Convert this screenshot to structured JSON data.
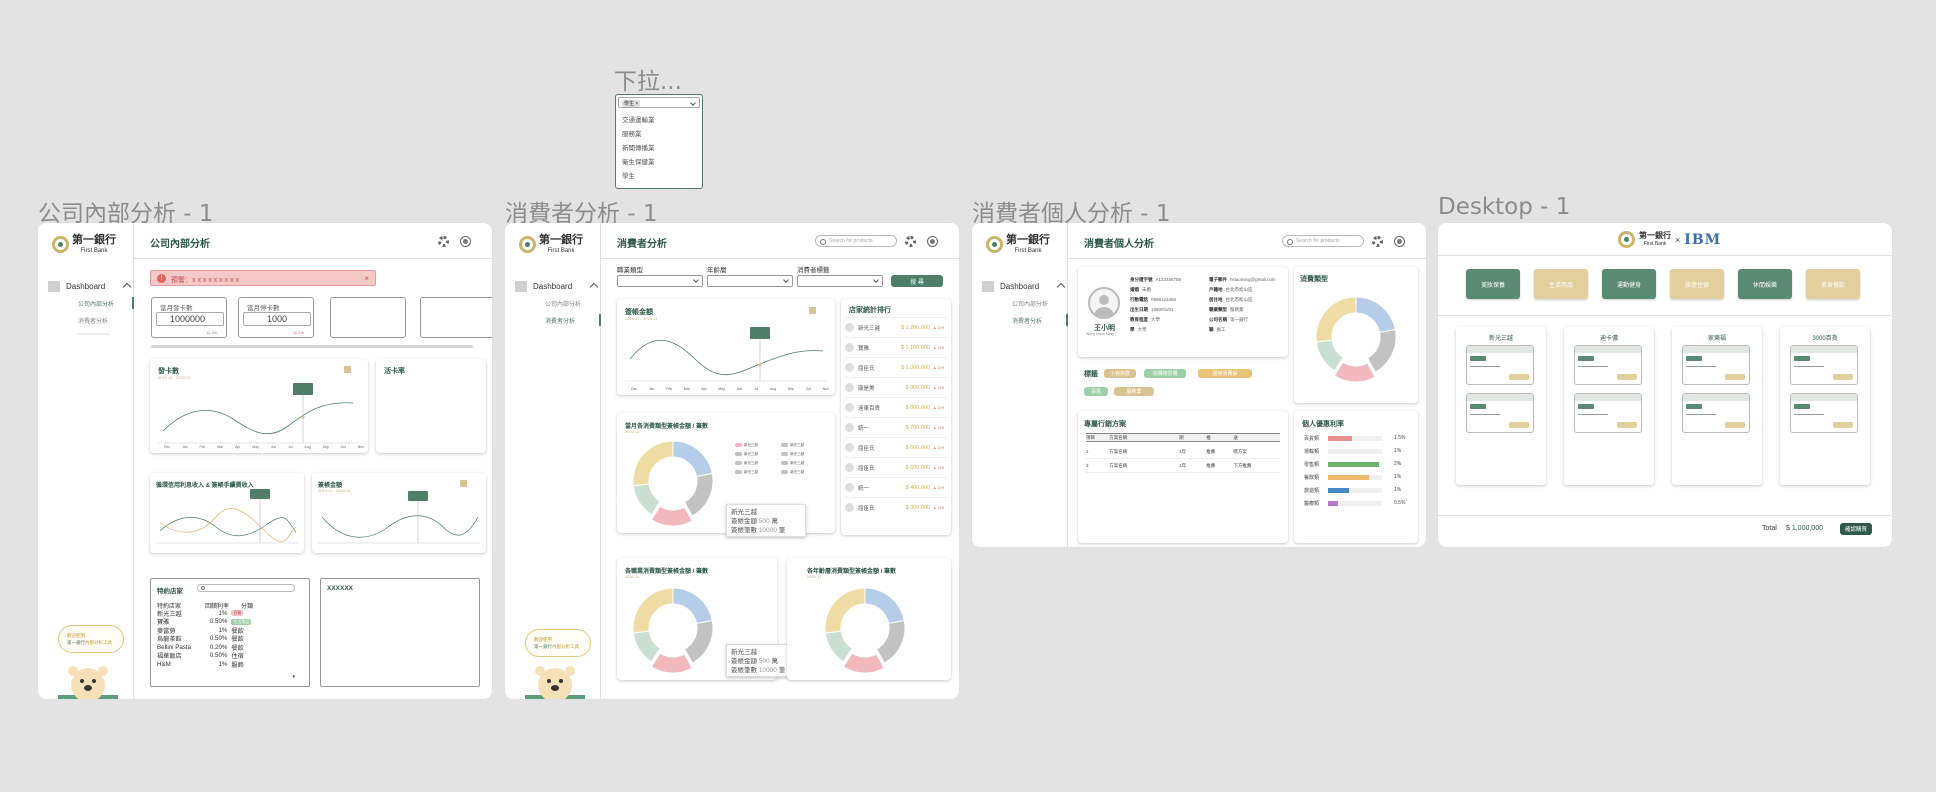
{
  "dropdown_annotation": {
    "title": "下拉...",
    "chip": "學生 ×",
    "options": [
      "交通運輸業",
      "服務業",
      "新聞傳播業",
      "衛生保健業",
      "學生"
    ]
  },
  "frame_titles": [
    "公司內部分析 - 1",
    "消費者分析 - 1",
    "消費者個人分析 - 1",
    "Desktop - 1"
  ],
  "brand": {
    "name_zh": "第一銀行",
    "name_en": "First Bank",
    "partner": "IBM",
    "x": "×"
  },
  "colors": {
    "primary": "#4e7e68",
    "gold": "#d9c48f",
    "alert": "#f6c9c9",
    "pie_blue": "#b5cde9",
    "pie_gray": "#c2c2c2",
    "pie_pink": "#f2b8bb",
    "pie_mint": "#c9dfd0",
    "pie_yellow": "#eedca4"
  },
  "icons": [
    "settings-gear-icon",
    "user-avatar-icon",
    "search-icon",
    "close-icon",
    "chevron-down-icon",
    "nav-square-icon"
  ],
  "sidebar": {
    "dashboard": "Dashboard",
    "items": [
      "公司內部分析",
      "消費者分析"
    ],
    "bubble1": "歡迎使用",
    "bubble2": "第一銀行",
    "bubble3": "內部分析工具"
  },
  "screen1": {
    "title": "公司內部分析",
    "alert": "預警：x x x x x x x x x",
    "kpi1": {
      "label": "當月發卡數",
      "value": "1000000",
      "delta": "11.1%"
    },
    "kpi2": {
      "label": "當月停卡數",
      "value": "1000",
      "delta": "11.1%"
    },
    "chart1_title": "發卡數",
    "chart1_date": "2019.12 - 2020.11",
    "chart2_title": "活卡率",
    "chart3_title": "循環信用利息收入 & 簽帳手續費收入",
    "chart4_title": "簽帳金額",
    "chart4_date": "2019.12 - 2020.11",
    "months": [
      "Dec",
      "Jan",
      "Feb",
      "Mar",
      "Apr",
      "May",
      "Jun",
      "Jul",
      "Aug",
      "Sep",
      "Oct",
      "Nov"
    ],
    "partner_title": "特約店家",
    "partner_headers": [
      "特約店家",
      "回饋利率",
      "分類"
    ],
    "partners": [
      {
        "name": "新光三越",
        "rate": "1%",
        "cat": "百貨"
      },
      {
        "name": "寶雅",
        "rate": "0.50%",
        "cat": "生活用品"
      },
      {
        "name": "麥當勞",
        "rate": "1%",
        "cat": "餐飲"
      },
      {
        "name": "烏龍茶館",
        "rate": "0.50%",
        "cat": "餐飲"
      },
      {
        "name": "Bellini Pasta",
        "rate": "0.20%",
        "cat": "餐飲"
      },
      {
        "name": "福華飯店",
        "rate": "0.50%",
        "cat": "住宿"
      },
      {
        "name": "H&M",
        "rate": "1%",
        "cat": "服飾"
      }
    ],
    "box_title": "XXXXXX"
  },
  "screen2": {
    "title": "消費者分析",
    "search_placeholder": "Search for products",
    "filter_labels": [
      "職業類型",
      "年齡層",
      "消費者標籤"
    ],
    "search_btn": "搜 尋",
    "line_title": "簽帳金額",
    "line_date": "2019.12 - 2020.11",
    "rank_title": "店家統計排行",
    "rank": [
      {
        "name": "新光三越",
        "amount": "$ 1,200,000",
        "delta": "11%"
      },
      {
        "name": "寶雅",
        "amount": "$ 1,100,000",
        "delta": "11%"
      },
      {
        "name": "屈臣氏",
        "amount": "$ 1,000,000",
        "delta": "11%"
      },
      {
        "name": "康是美",
        "amount": "$ 900,000",
        "delta": "11%"
      },
      {
        "name": "遠東百貨",
        "amount": "$ 800,000",
        "delta": "11%"
      },
      {
        "name": "統一",
        "amount": "$ 700,000",
        "delta": "11%"
      },
      {
        "name": "屈臣氏",
        "amount": "$ 600,000",
        "delta": "11%"
      },
      {
        "name": "屈臣氏",
        "amount": "$ 500,000",
        "delta": "11%"
      },
      {
        "name": "統一",
        "amount": "$ 400,000",
        "delta": "11%"
      },
      {
        "name": "屈臣氏",
        "amount": "$ 300,000",
        "delta": "11%"
      }
    ],
    "pie1_title": "當月各消費類型簽帳金額 / 筆數",
    "pie1_date": "2020.11",
    "legend_items": [
      "新光三越",
      "新光三越",
      "新光三越",
      "新光三越",
      "新光三越",
      "新光三越",
      "新光三越",
      "新光三越"
    ],
    "tooltip": {
      "title": "新光三越",
      "amount_label": "簽帳金額",
      "amount": "500",
      "amount_unit": "萬",
      "count_label": "簽帳筆數",
      "count": "10000",
      "count_unit": "筆"
    },
    "pie2_title": "各職業消費類型簽帳金額 / 筆數",
    "pie2_date": "2020.11",
    "pie3_title": "各年齡層消費類型簽帳金額 / 筆數",
    "pie3_date": "2020.11"
  },
  "screen3": {
    "title": "消費者個人分析",
    "search_placeholder": "Search for products",
    "profile": {
      "name": "王小明",
      "name_en": "Wang Hsiao Ming"
    },
    "info": [
      {
        "k": "身分證字號",
        "v": "A123456789"
      },
      {
        "k": "電子郵件",
        "v": "hsiaoming@gmail.com"
      },
      {
        "k": "婚姻",
        "v": "未婚"
      },
      {
        "k": "戶籍地",
        "v": "台北市松山區"
      },
      {
        "k": "行動電話",
        "v": "0988123456"
      },
      {
        "k": "居住地",
        "v": "台北市松山區"
      },
      {
        "k": "出生日期",
        "v": "1990/01/01"
      },
      {
        "k": "職業類型",
        "v": "服務業"
      },
      {
        "k": "教育程度",
        "v": "大學"
      },
      {
        "k": "公司名稱",
        "v": "第一銀行"
      },
      {
        "k": "學",
        "v": "大學"
      },
      {
        "k": "職",
        "v": "員工"
      }
    ],
    "type_title": "消費類型",
    "tags_title": "標籤",
    "tags": [
      "小資族群",
      "有購物習慣",
      "經常消費保",
      "百貨",
      "服務業"
    ],
    "plan_title": "專屬行銷方案",
    "plan_headers": [
      "項目",
      "方案名稱",
      "期",
      "推",
      "送"
    ],
    "plans": [
      {
        "no": "1",
        "name": "方案名稱",
        "period": "1年",
        "rep": "推薦",
        "note": "贈方案"
      },
      {
        "no": "2",
        "name": "方案名稱",
        "period": "1年",
        "rep": "推薦",
        "note": "下方推薦"
      }
    ],
    "bonus_title": "個人優惠利率",
    "bonus": [
      {
        "label": "百貨類",
        "value": "1.5%",
        "pct": 0.45,
        "color": "#e88f8f"
      },
      {
        "label": "運輸類",
        "value": "1%",
        "pct": 0.0,
        "color": "#a9c7e6"
      },
      {
        "label": "零售類",
        "value": "2%",
        "pct": 0.95,
        "color": "#6db36f"
      },
      {
        "label": "餐飲類",
        "value": "1%",
        "pct": 0.75,
        "color": "#f0bb6c"
      },
      {
        "label": "旅遊類",
        "value": "1%",
        "pct": 0.38,
        "color": "#4a87c5"
      },
      {
        "label": "醫療類",
        "value": "0.5%",
        "pct": 0.18,
        "color": "#b777c8"
      }
    ]
  },
  "screen4": {
    "top_buttons": [
      "美妝保養",
      "生活用品",
      "運動健身",
      "旅遊住宿",
      "休閒娛樂",
      "美食餐飲"
    ],
    "columns": [
      "新光三越",
      "迪卡儂",
      "家樂福",
      "3000百貨"
    ],
    "total_label": "Total",
    "total_value": "$ 1,000,000",
    "confirm_btn": "確認購買"
  }
}
